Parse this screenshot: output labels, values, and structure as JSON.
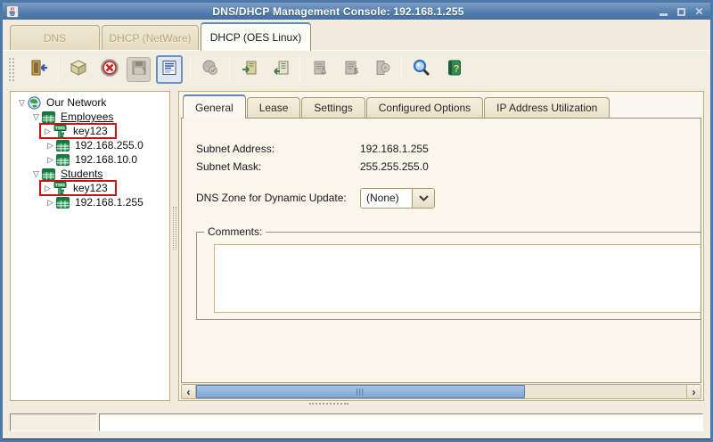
{
  "window": {
    "title": "DNS/DHCP Management Console: 192.168.1.255",
    "controls": {
      "minimize": "",
      "maximize": "",
      "close": "✕"
    }
  },
  "colors": {
    "titlebar_blue": "#527ead",
    "annotation_red": "#cc1111",
    "scrollbar_thumb_blue": "#7fa6d6",
    "selected_tool_highlight": "#6b8fbe",
    "active_tab_edge": "#5d88ba"
  },
  "main_tabs": [
    {
      "label": "DNS",
      "state": "disabled"
    },
    {
      "label": "DHCP (NetWare)",
      "state": "disabled"
    },
    {
      "label": "DHCP (OES Linux)",
      "state": "active"
    }
  ],
  "toolbar": {
    "buttons": [
      {
        "name": "exit-button",
        "icon": "exit-door-icon",
        "state": "enabled"
      },
      {
        "name": "create-button",
        "icon": "cube-icon",
        "state": "enabled"
      },
      {
        "name": "delete-button",
        "icon": "delete-x-icon",
        "state": "enabled"
      },
      {
        "name": "save-button",
        "icon": "floppy-disk-icon",
        "state": "disabled"
      },
      {
        "name": "details-view-button",
        "icon": "list-view-icon",
        "state": "selected"
      },
      {
        "name": "verify-button",
        "icon": "globe-check-icon",
        "state": "disabled"
      },
      {
        "name": "import-button",
        "icon": "import-arrow-icon",
        "state": "enabled"
      },
      {
        "name": "export-button",
        "icon": "export-arrow-icon",
        "state": "enabled"
      },
      {
        "name": "alerts-button",
        "icon": "document-alert-icon",
        "state": "disabled"
      },
      {
        "name": "accounting-button",
        "icon": "document-dollar-icon",
        "state": "disabled"
      },
      {
        "name": "options-button",
        "icon": "door-globe-icon",
        "state": "disabled"
      },
      {
        "name": "search-button",
        "icon": "magnifier-icon",
        "state": "enabled"
      },
      {
        "name": "help-button",
        "icon": "help-book-icon",
        "state": "enabled"
      }
    ]
  },
  "tree": {
    "expanded_glyph": "▽",
    "collapsed_glyph": "▷",
    "items": [
      {
        "label": "Our Network",
        "icon": "globe-icon",
        "level": 0,
        "expanded": true
      },
      {
        "label": "Employees",
        "icon": "subnet-table-icon",
        "level": 1,
        "expanded": true,
        "underlined": true
      },
      {
        "label": "key123",
        "icon": "tsig-key-icon",
        "level": 2,
        "expanded": false,
        "annotated": true
      },
      {
        "label": "192.168.255.0",
        "icon": "subnet-table-icon",
        "level": 2,
        "expanded": false
      },
      {
        "label": "192.168.10.0",
        "icon": "subnet-table-icon",
        "level": 2,
        "expanded": false
      },
      {
        "label": "Students",
        "icon": "subnet-table-icon",
        "level": 1,
        "expanded": true,
        "underlined": true
      },
      {
        "label": "key123",
        "icon": "tsig-key-icon",
        "level": 2,
        "expanded": false,
        "annotated": true
      },
      {
        "label": "192.168.1.255",
        "icon": "subnet-table-icon",
        "level": 2,
        "expanded": false
      }
    ]
  },
  "inner_tabs": [
    {
      "label": "General",
      "state": "active"
    },
    {
      "label": "Lease",
      "state": "normal"
    },
    {
      "label": "Settings",
      "state": "normal"
    },
    {
      "label": "Configured Options",
      "state": "normal"
    },
    {
      "label": "IP Address Utilization",
      "state": "normal"
    }
  ],
  "general_tab": {
    "subnet_address_label": "Subnet Address:",
    "subnet_address_value": "192.168.1.255",
    "subnet_mask_label": "Subnet Mask:",
    "subnet_mask_value": "255.255.255.0",
    "dns_zone_label": "DNS Zone for Dynamic Update:",
    "dns_zone_value": "(None)",
    "comments_label": "Comments:",
    "comments_value": ""
  },
  "scrollbar": {
    "left_arrow": "‹",
    "right_arrow": "›",
    "grip": "|||",
    "thumb_fraction": 0.67
  },
  "status": {
    "left": "",
    "right": ""
  }
}
